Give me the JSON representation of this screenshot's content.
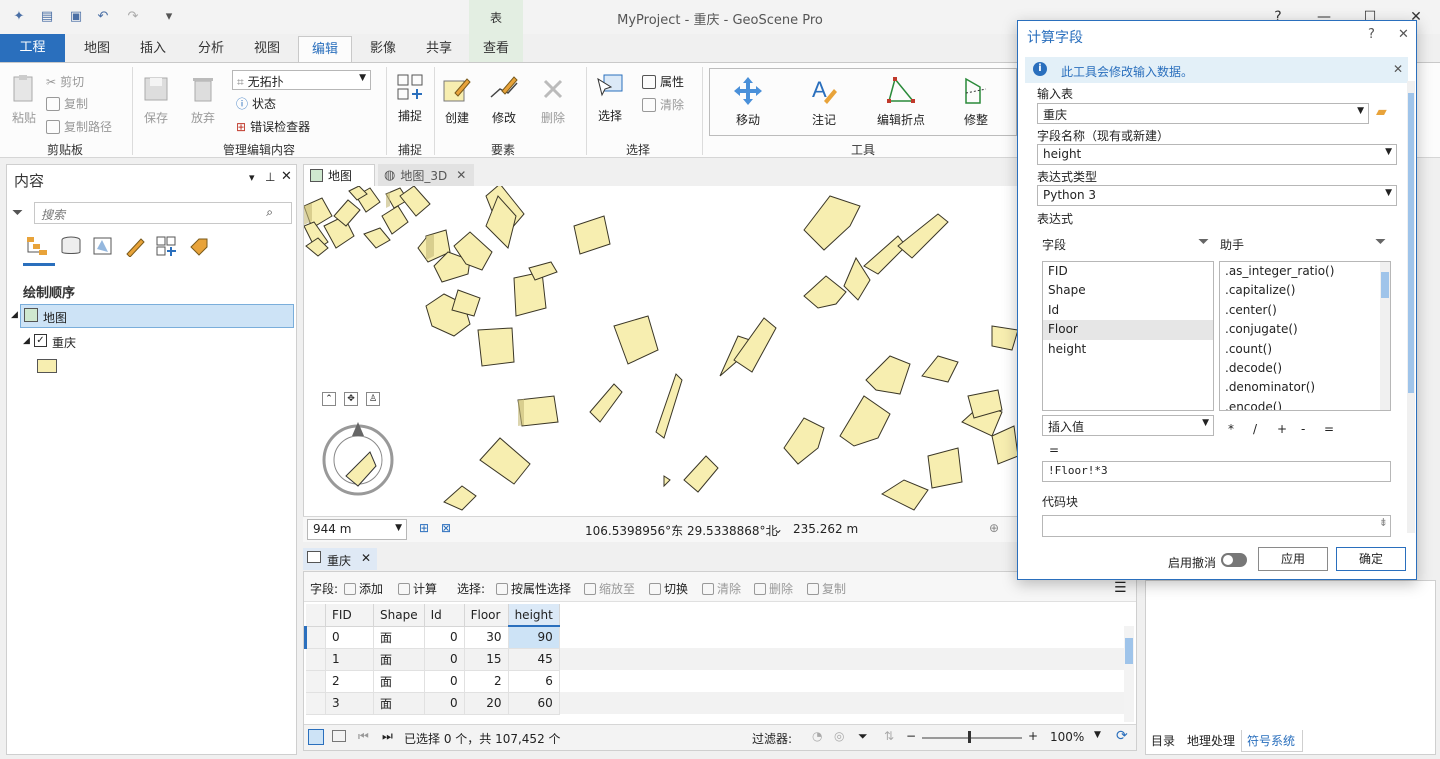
{
  "app": {
    "title": "MyProject - 重庆 - GeoScene Pro",
    "context_group": "表",
    "help": "?",
    "window_controls": [
      "—",
      "☐",
      "✕"
    ]
  },
  "tabs": [
    "工程",
    "地图",
    "插入",
    "分析",
    "视图",
    "编辑",
    "影像",
    "共享",
    "查看"
  ],
  "active_tab": "编辑",
  "ribbon": {
    "clipboard": {
      "paste": "粘贴",
      "cut": "剪切",
      "copy": "复制",
      "copy_path": "复制路径",
      "label": "剪贴板"
    },
    "manage": {
      "save": "保存",
      "discard": "放弃",
      "topology": "无拓扑",
      "status": "状态",
      "error_inspector": "错误检查器",
      "label": "管理编辑内容"
    },
    "snapping": {
      "snap": "捕捉",
      "label": "捕捉"
    },
    "features": {
      "create": "创建",
      "modify": "修改",
      "delete": "删除",
      "label": "要素"
    },
    "selection": {
      "select": "选择",
      "attributes": "属性",
      "clear": "清除",
      "label": "选择"
    },
    "tools": {
      "move": "移动",
      "annotate": "注记",
      "edit_vertices": "编辑折点",
      "reshape": "修整",
      "label": "工具"
    }
  },
  "contents": {
    "title": "内容",
    "search_placeholder": "搜索",
    "drawing_order": "绘制顺序",
    "map_layer": "地图",
    "layer": "重庆"
  },
  "map_tabs": [
    {
      "label": "地图",
      "active": true
    },
    {
      "label": "地图_3D",
      "active": false
    }
  ],
  "map_status": {
    "scale": "944 m",
    "coords": "106.5398956°东 29.5338868°北",
    "elevation": "235.262 m"
  },
  "table": {
    "tab_label": "重庆",
    "toolbar": {
      "fields_label": "字段:",
      "add": "添加",
      "calculate": "计算",
      "selection_label": "选择:",
      "select_by_attr": "按属性选择",
      "zoom_to": "缩放至",
      "switch": "切换",
      "clear": "清除",
      "delete": "删除",
      "copy": "复制"
    },
    "columns": [
      "FID",
      "Shape",
      "Id",
      "Floor",
      "height"
    ],
    "rows": [
      [
        "0",
        "面",
        "0",
        "30",
        "90"
      ],
      [
        "1",
        "面",
        "0",
        "15",
        "45"
      ],
      [
        "2",
        "面",
        "0",
        "2",
        "6"
      ],
      [
        "3",
        "面",
        "0",
        "20",
        "60"
      ]
    ],
    "status": "已选择 0 个，共 107,452 个",
    "filter_label": "过滤器:",
    "zoom": "100%"
  },
  "right_tabs": [
    "目录",
    "地理处理",
    "符号系统"
  ],
  "dialog": {
    "title": "计算字段",
    "help": "?",
    "info": "此工具会修改输入数据。",
    "input_table_label": "输入表",
    "input_table": "重庆",
    "field_name_label": "字段名称（现有或新建）",
    "field_name": "height",
    "expr_type_label": "表达式类型",
    "expr_type": "Python 3",
    "expression_label": "表达式",
    "fields_header": "字段",
    "helpers_header": "助手",
    "fields": [
      "FID",
      "Shape",
      "Id",
      "Floor",
      "height"
    ],
    "helpers": [
      ".as_integer_ratio()",
      ".capitalize()",
      ".center()",
      ".conjugate()",
      ".count()",
      ".decode()",
      ".denominator()",
      ".encode()"
    ],
    "insert_values": "插入值",
    "operators": [
      "*",
      "/",
      "+",
      "-",
      "="
    ],
    "equals": "=",
    "expression": "!Floor!*3",
    "code_block_label": "代码块",
    "undo_label": "启用撤消",
    "apply": "应用",
    "ok": "确定"
  },
  "colors": {
    "accent": "#2a6fbd",
    "building_fill": "#f7eeb0",
    "building_stroke": "#5a5436"
  }
}
